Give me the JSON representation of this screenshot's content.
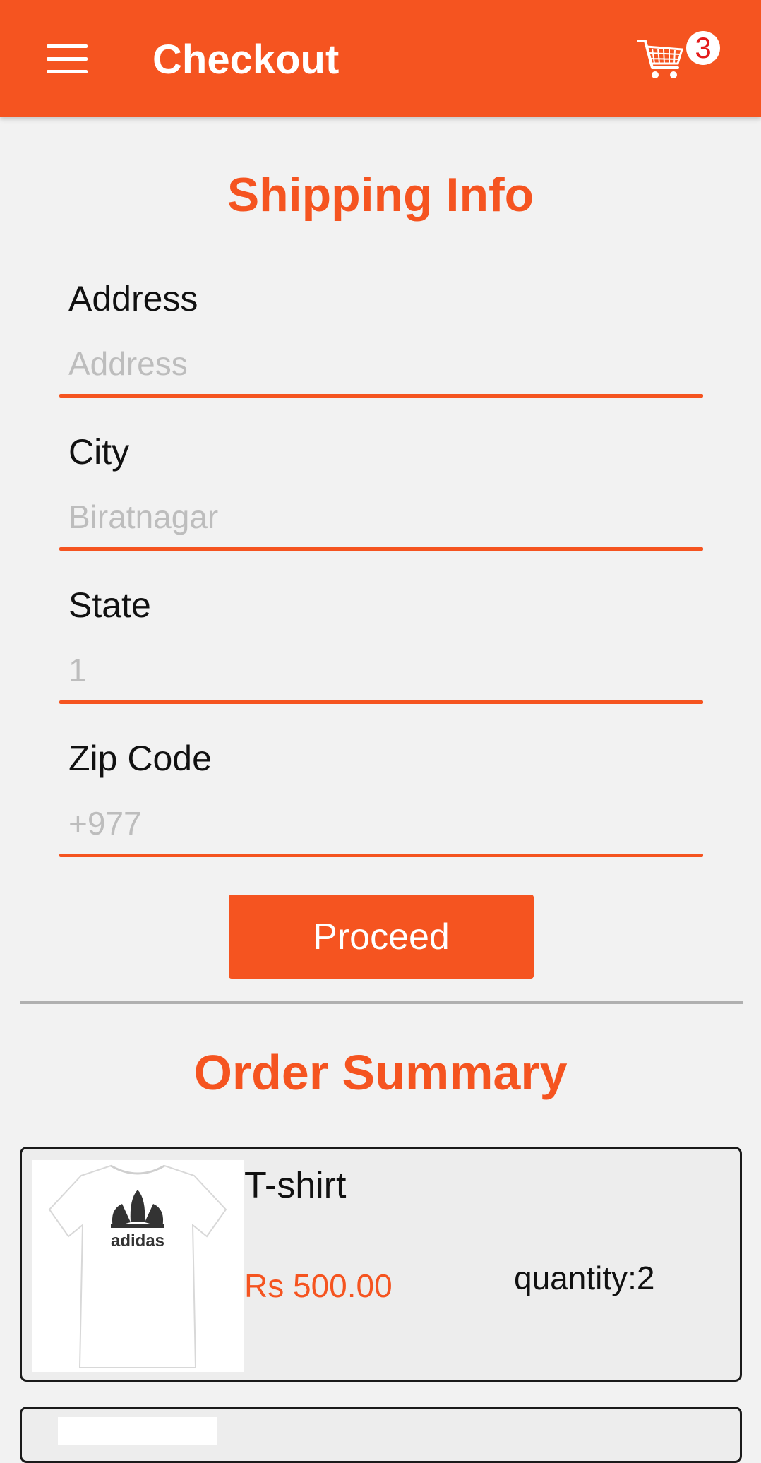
{
  "appbar": {
    "title": "Checkout",
    "cart_count": "3",
    "menu_icon": "menu-icon",
    "cart_icon": "shopping-cart-icon"
  },
  "shipping": {
    "title": "Shipping Info",
    "fields": [
      {
        "label": "Address",
        "placeholder": "Address"
      },
      {
        "label": "City",
        "placeholder": "Biratnagar"
      },
      {
        "label": "State",
        "placeholder": "1"
      },
      {
        "label": "Zip Code",
        "placeholder": "+977"
      }
    ],
    "proceed_label": "Proceed"
  },
  "order_summary": {
    "title": "Order Summary",
    "items": [
      {
        "name": "T-shirt",
        "price": "Rs 500.00",
        "quantity": "quantity:2",
        "image_icon": "adidas-tshirt-image"
      }
    ]
  },
  "colors": {
    "accent": "#f55420",
    "background": "#f2f2f2",
    "badge_text": "#e31b1b"
  }
}
